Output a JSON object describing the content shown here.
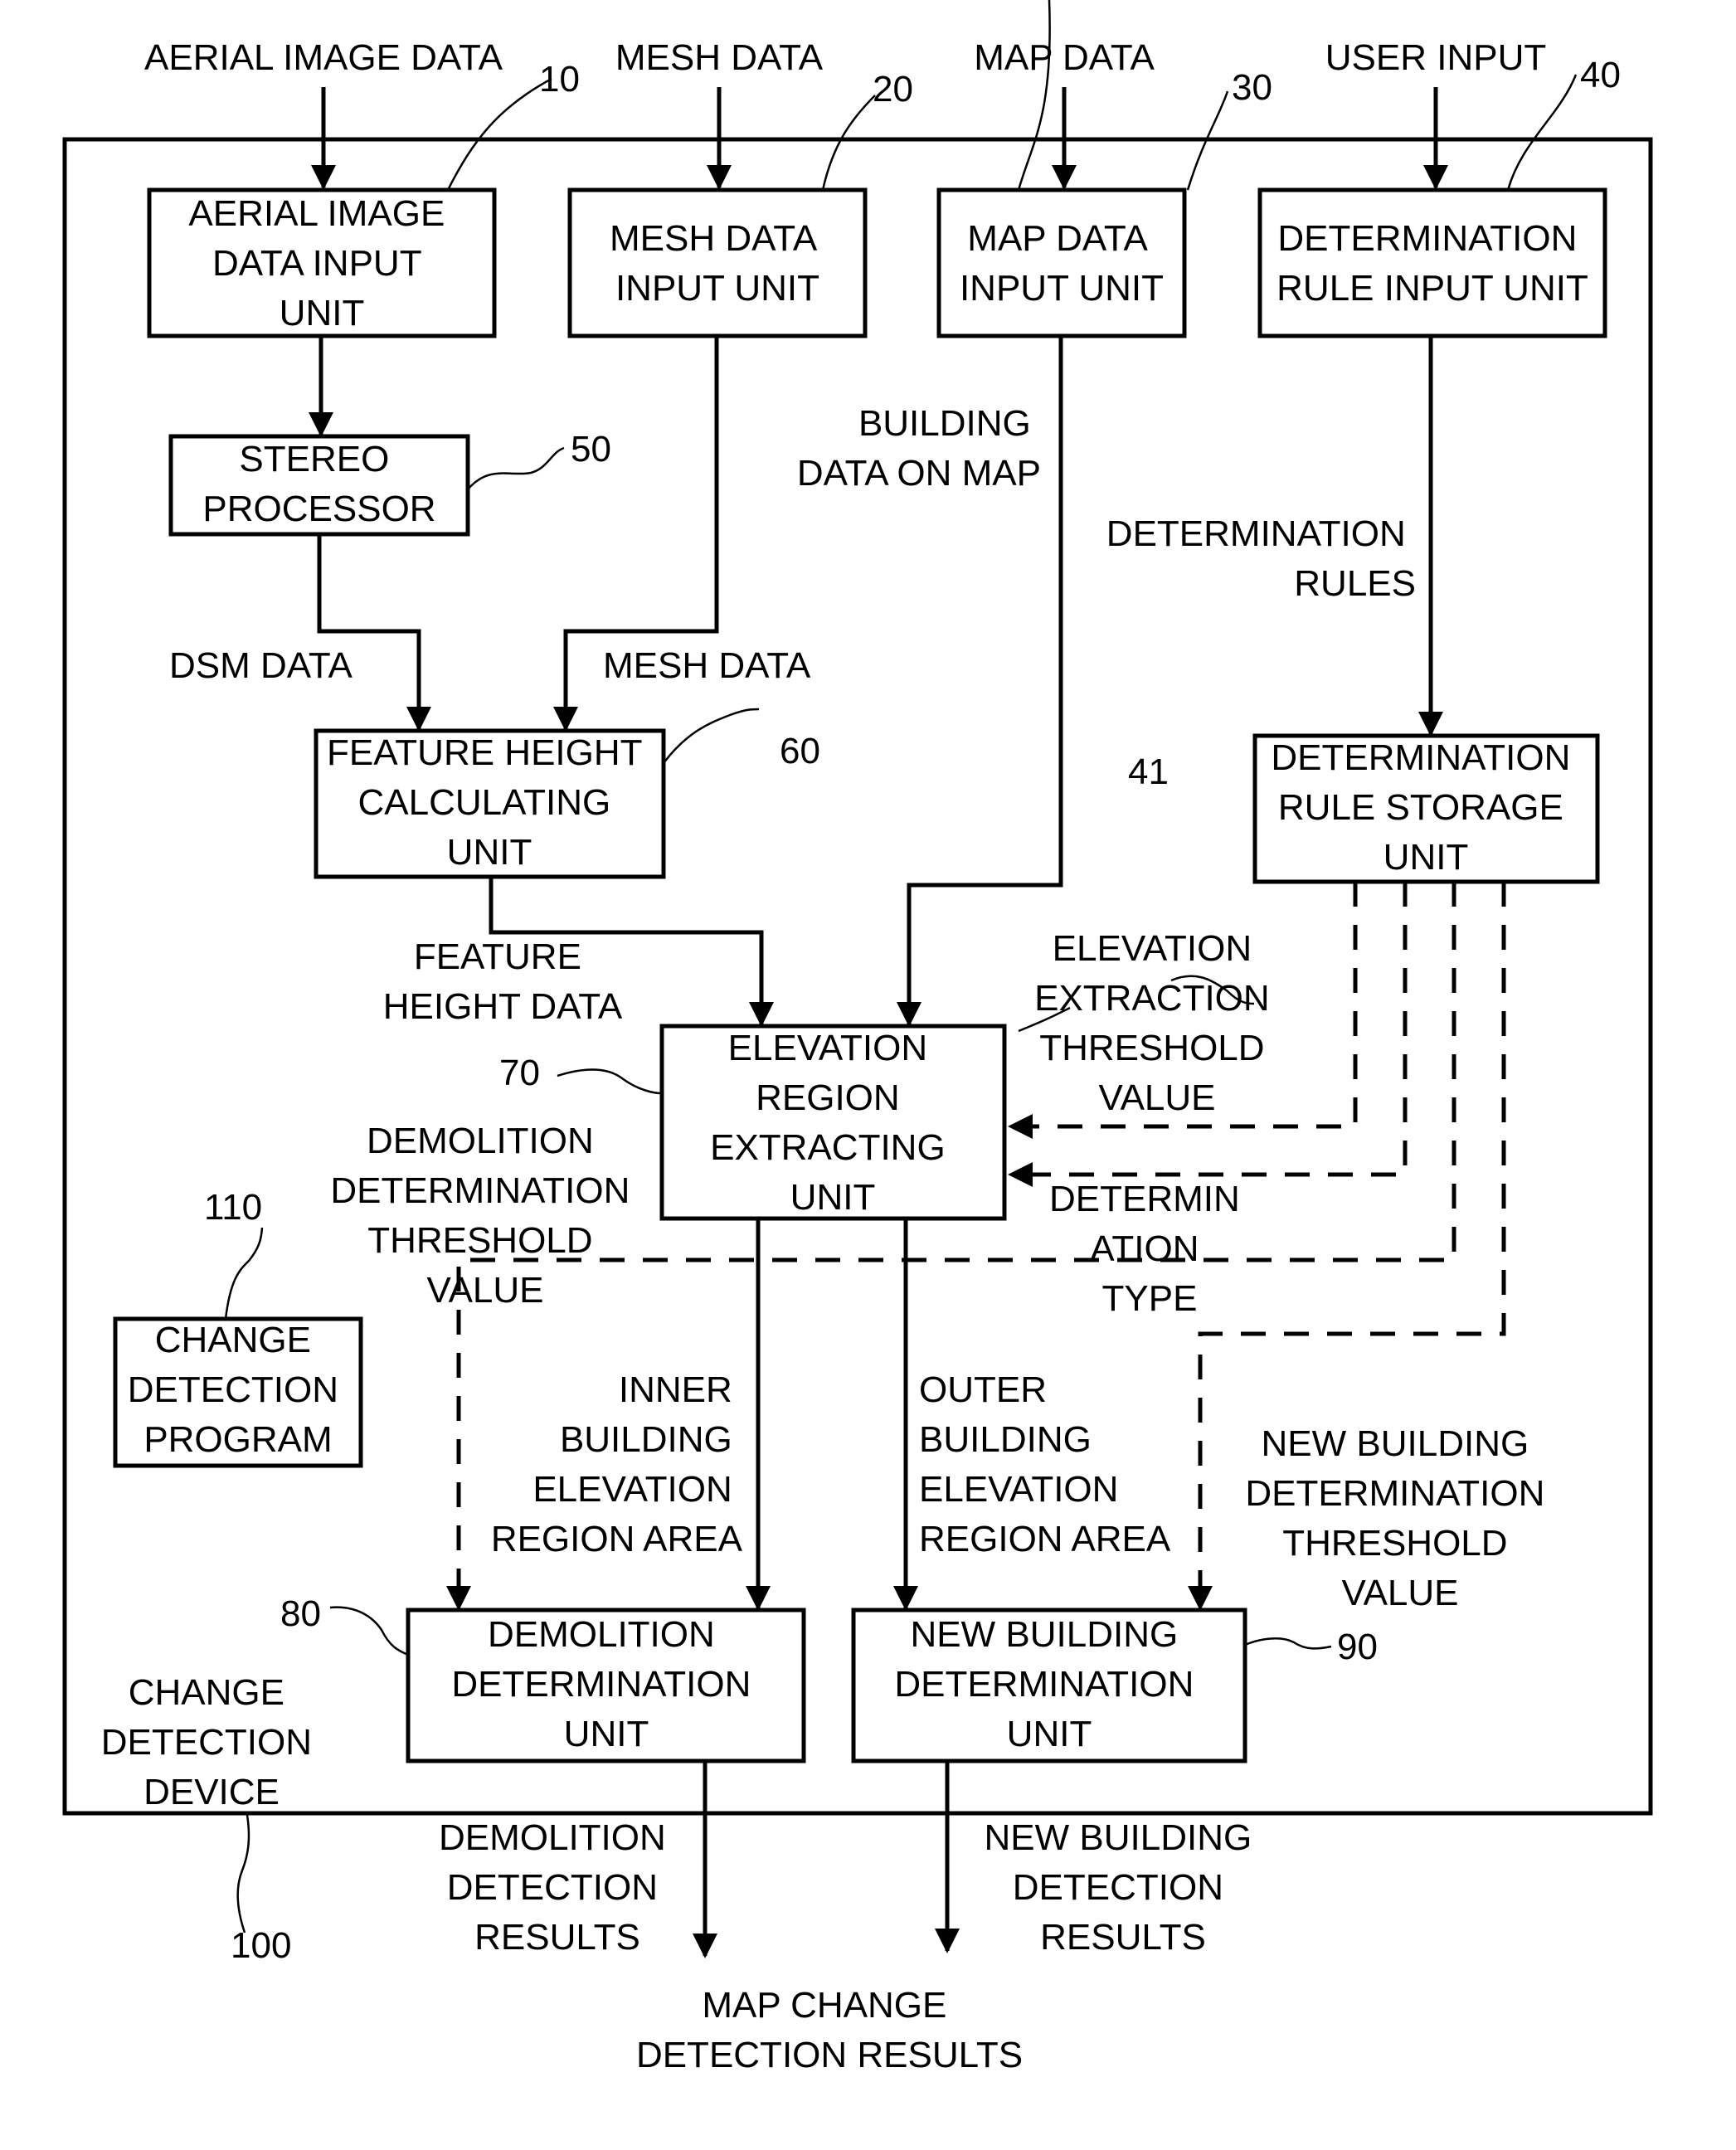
{
  "diagram": {
    "device_label": [
      "CHANGE",
      "DETECTION",
      "DEVICE"
    ],
    "device_ref": "100",
    "inputs": {
      "aerial_image_data": "AERIAL IMAGE DATA",
      "mesh_data": "MESH DATA",
      "map_data": "MAP DATA",
      "user_input": "USER INPUT"
    },
    "units": {
      "aerial_input": {
        "ref": "10",
        "lines": [
          "AERIAL IMAGE",
          "DATA INPUT",
          "UNIT"
        ]
      },
      "mesh_input": {
        "ref": "20",
        "lines": [
          "MESH DATA",
          "INPUT UNIT"
        ]
      },
      "map_input": {
        "ref": "30",
        "lines": [
          "MAP DATA",
          "INPUT UNIT"
        ]
      },
      "rule_input": {
        "ref": "40",
        "lines": [
          "DETERMINATION",
          "RULE INPUT UNIT"
        ]
      },
      "rule_storage": {
        "ref": "41",
        "lines": [
          "DETERMINATION",
          "RULE STORAGE",
          "UNIT"
        ]
      },
      "stereo": {
        "ref": "50",
        "lines": [
          "STEREO",
          "PROCESSOR"
        ]
      },
      "feature_height": {
        "ref": "60",
        "lines": [
          "FEATURE HEIGHT",
          "CALCULATING",
          "UNIT"
        ]
      },
      "elevation_region": {
        "ref": "70",
        "lines": [
          "ELEVATION",
          "REGION",
          "EXTRACTING",
          "UNIT"
        ]
      },
      "demolition": {
        "ref": "80",
        "lines": [
          "DEMOLITION",
          "DETERMINATION",
          "UNIT"
        ]
      },
      "new_building": {
        "ref": "90",
        "lines": [
          "NEW BUILDING",
          "DETERMINATION",
          "UNIT"
        ]
      },
      "program": {
        "ref": "110",
        "lines": [
          "CHANGE",
          "DETECTION",
          "PROGRAM"
        ]
      }
    },
    "flow_labels": {
      "building_data_on_map": [
        "BUILDING",
        "DATA ON MAP"
      ],
      "determination_rules": [
        "DETERMINATION",
        "RULES"
      ],
      "dsm_data": "DSM DATA",
      "mesh_data": "MESH DATA",
      "feature_height_data": [
        "FEATURE",
        "HEIGHT DATA"
      ],
      "elevation_extraction_threshold": [
        "ELEVATION",
        "EXTRACTION",
        "THRESHOLD",
        "VALUE"
      ],
      "determination_type": [
        "DETERMIN",
        "ATION",
        "TYPE"
      ],
      "demolition_threshold": [
        "DEMOLITION",
        "DETERMINATION",
        "THRESHOLD",
        "VALUE"
      ],
      "inner_area": [
        "INNER",
        "BUILDING",
        "ELEVATION",
        "REGION AREA"
      ],
      "outer_area": [
        "OUTER",
        "BUILDING",
        "ELEVATION",
        "REGION AREA"
      ],
      "new_building_threshold": [
        "NEW BUILDING",
        "DETERMINATION",
        "THRESHOLD",
        "VALUE"
      ],
      "demolition_results": [
        "DEMOLITION",
        "DETECTION",
        "RESULTS"
      ],
      "new_building_results": [
        "NEW BUILDING",
        "DETECTION",
        "RESULTS"
      ]
    },
    "output": [
      "MAP CHANGE",
      "DETECTION RESULTS"
    ]
  }
}
